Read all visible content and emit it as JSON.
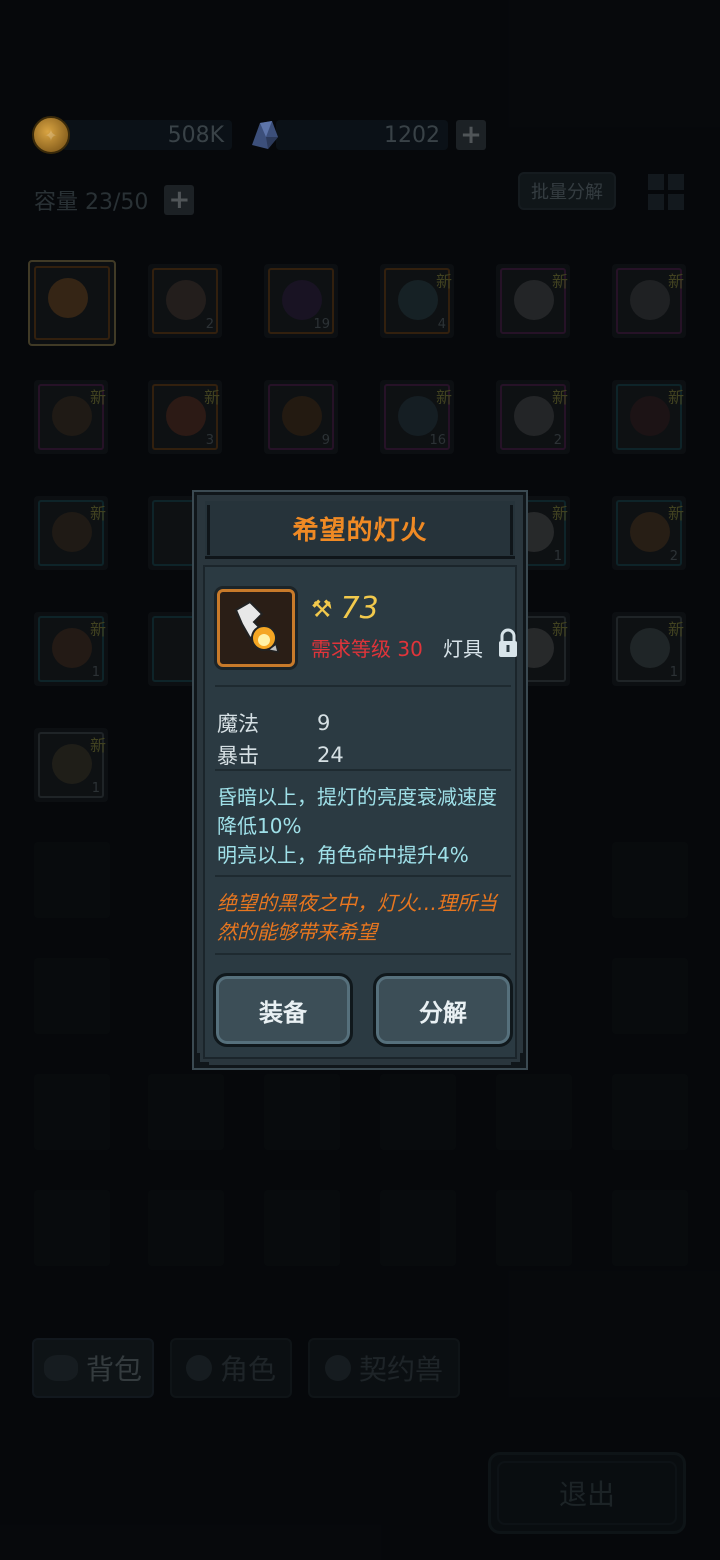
{
  "resources": {
    "coins": "508K",
    "gems": "1202"
  },
  "capacity": {
    "label": "容量 23/50"
  },
  "toolbar": {
    "batch_decompose": "批量分解"
  },
  "inventory": {
    "new_badge": "新",
    "row1": [
      {
        "count": ""
      },
      {
        "count": "2"
      },
      {
        "count": "19"
      },
      {
        "count": "4"
      },
      {
        "count": ""
      },
      {
        "count": ""
      }
    ],
    "row2": [
      {
        "count": ""
      },
      {
        "count": "3"
      },
      {
        "count": "9"
      },
      {
        "count": "16"
      },
      {
        "count": "2"
      },
      {
        "count": ""
      }
    ],
    "row3": [
      {
        "count": ""
      },
      {
        "count": ""
      },
      {
        "count": "1"
      },
      {
        "count": "2"
      }
    ],
    "row4": [
      {
        "count": "1"
      },
      {
        "count": ""
      },
      {
        "count": ""
      },
      {
        "count": "1"
      }
    ],
    "row5": [
      {
        "count": "1"
      }
    ]
  },
  "tabs": {
    "backpack": "背包",
    "character": "角色",
    "pet": "契约兽"
  },
  "exit": {
    "label": "退出"
  },
  "modal": {
    "title": "希望的灯火",
    "power": "73",
    "requirement": "需求等级 30",
    "item_type": "灯具",
    "stats": [
      {
        "name": "魔法",
        "value": "9"
      },
      {
        "name": "暴击",
        "value": "24"
      }
    ],
    "effects": [
      "昏暗以上，提灯的亮度衰减速度降低10%",
      "明亮以上，角色命中提升4%"
    ],
    "lore": "绝望的黑夜之中，灯火…理所当然的能够带来希望",
    "equip_label": "装备",
    "decompose_label": "分解"
  },
  "colors": {
    "title": "#f08a24",
    "requirement": "#e0343a",
    "power": "#f2c94c",
    "effects": "#9fe0e8",
    "lore": "#e8761f"
  }
}
